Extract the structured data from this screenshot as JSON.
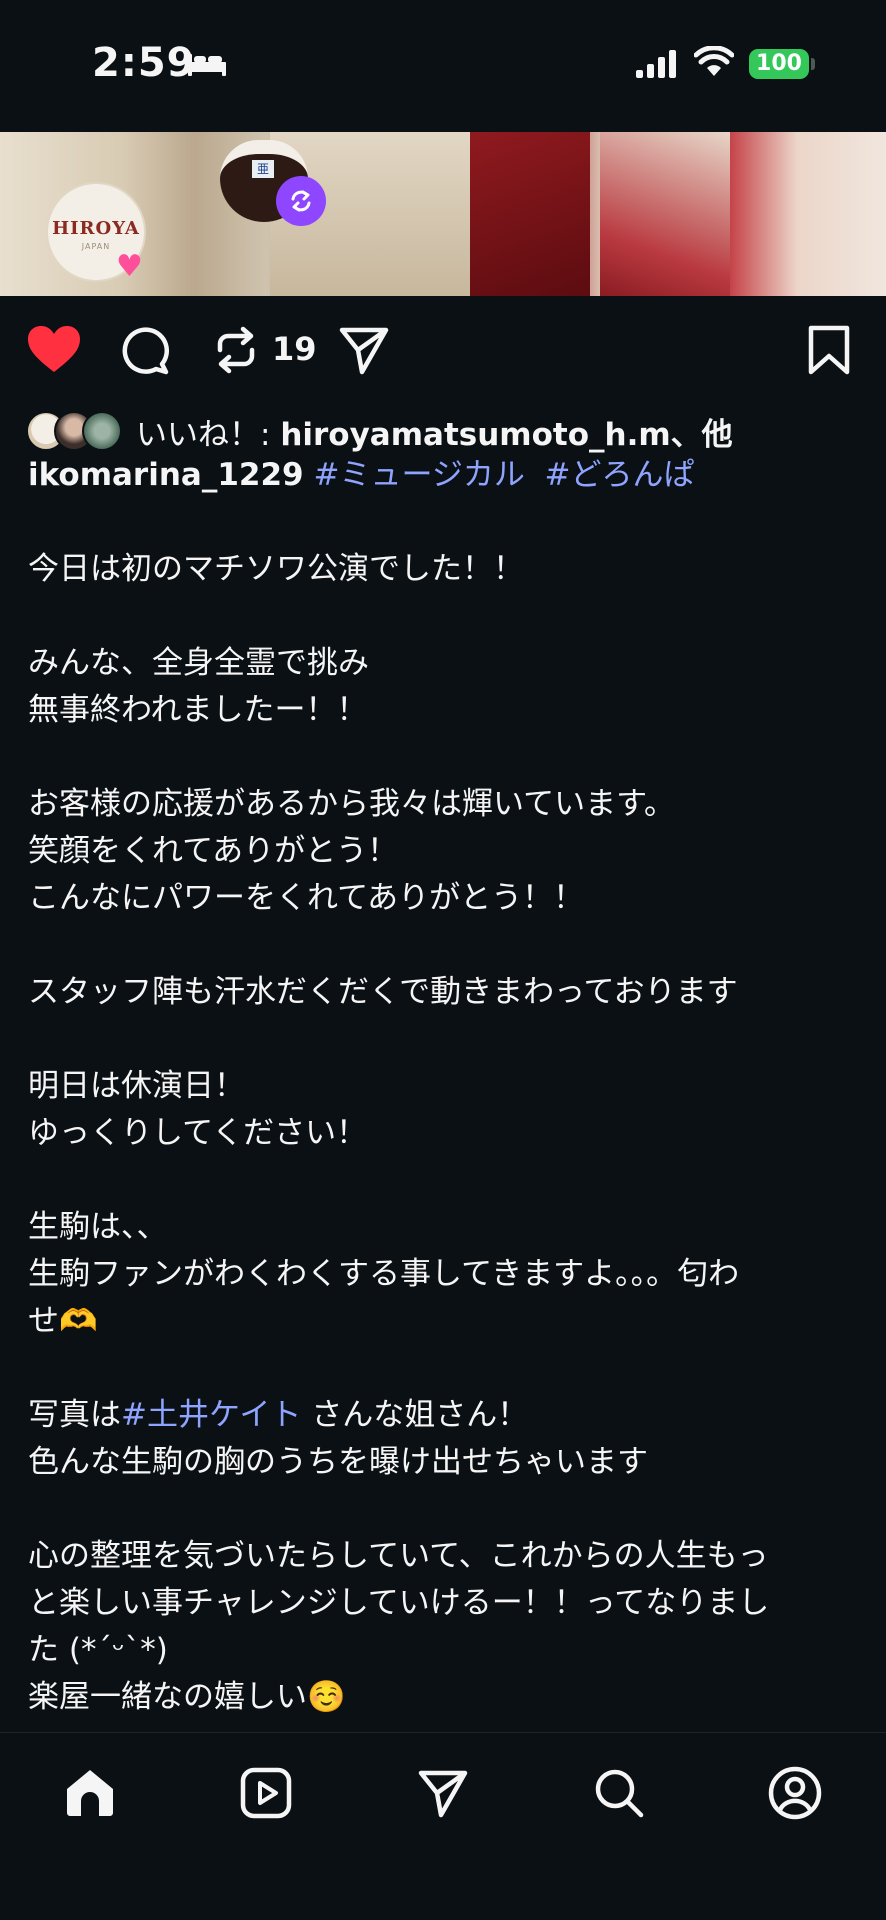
{
  "status_bar": {
    "time": "2:59",
    "battery": "100",
    "battery_color": "#34c759"
  },
  "media": {
    "logo_text": "HIROYA",
    "logo_subtext": "JAPAN",
    "bowl_label": "亜"
  },
  "actions": {
    "liked": true,
    "like_color": "#ff3040",
    "repost_count": "19",
    "icons": [
      "heart-icon",
      "comment-icon",
      "repost-icon",
      "share-icon",
      "bookmark-icon"
    ]
  },
  "likes": {
    "prefix": "いいね！: ",
    "user": "hiroyamatsumoto_h.m",
    "suffix": "、他"
  },
  "caption": {
    "username": "ikomarina_1229",
    "tag1": "#ミュージカル",
    "tag2": "#どろんぱ",
    "l1": "今日は初のマチソワ公演でした！！",
    "l2": "みんな、全身全霊で挑み",
    "l3": "無事終われましたー！！",
    "l4": "お客様の応援があるから我々は輝いています。",
    "l5": "笑顔をくれてありがとう！",
    "l6": "こんなにパワーをくれてありがとう！！",
    "l7": "スタッフ陣も汗水だくだくで動きまわっております",
    "l8": "明日は休演日！",
    "l9": "ゆっくりしてください！",
    "l10": "生駒は、、",
    "l11": "生駒ファンがわくわくする事してきますよ。。。匂わ",
    "l12": "せ🫶",
    "l13_pre": "写真は",
    "l13_tag": "#土井ケイト",
    "l13_post": " さんな姐さん！",
    "l14": "色んな生駒の胸のうちを曝け出せちゃいます",
    "l15": "心の整理を気づいたらしていて、これからの人生もっ",
    "l16": "と楽しい事チャレンジしていけるー！！ってなりまし",
    "l17": "た (*´ᵕ`*)",
    "l18": "楽屋一緒なの嬉しい☺️"
  },
  "nav": {
    "items": [
      "home-icon",
      "reels-icon",
      "direct-icon",
      "search-icon",
      "profile-icon"
    ],
    "active": "home-icon"
  },
  "colors": {
    "background": "#0b1014",
    "hashtag": "#8ea4ff"
  }
}
